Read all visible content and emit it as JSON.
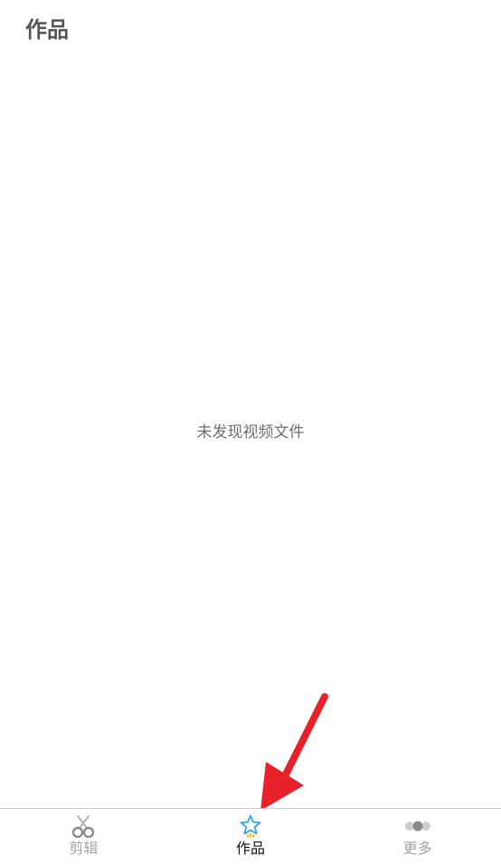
{
  "header": {
    "title": "作品"
  },
  "main": {
    "empty_message": "未发现视频文件"
  },
  "tabbar": {
    "tabs": [
      {
        "label": "剪辑",
        "icon": "scissors-icon",
        "active": false
      },
      {
        "label": "作品",
        "icon": "star-icon",
        "active": true
      },
      {
        "label": "更多",
        "icon": "more-dots-icon",
        "active": false
      }
    ]
  },
  "colors": {
    "active_icon": "#2fa6e6",
    "accent_yellow": "#f4b400",
    "inactive": "#a3a3a3",
    "annotation_arrow": "#e8202a"
  }
}
